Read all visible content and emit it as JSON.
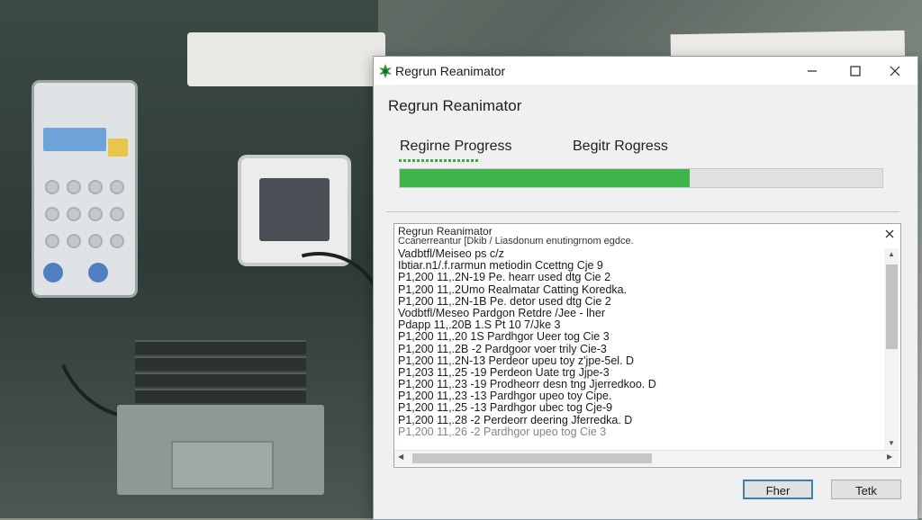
{
  "window": {
    "title": "Regrun Reanimator",
    "controls": {
      "minimize_icon": "minimize-icon",
      "maximize_icon": "maximize-icon",
      "close_icon": "close-icon"
    }
  },
  "main": {
    "heading": "Regrun Reanimator",
    "progress_label_1": "Regirne Progress",
    "progress_label_2": "Begitr Rogress",
    "progress_fraction": 0.6,
    "progress_color": "#40b34a"
  },
  "log": {
    "title": "Regrun Reanimator",
    "subtitle": "Ccanerreantur [Dkib / Liasdonum enutingrnom egdce.",
    "lines": [
      "Vadbtfl/Meiseo ps c/z",
      "Ibtiar.n1/.f.rarmun metiodin Ccettng Cje 9",
      "P1,200 11,.2N-19 Pe. hearr used dtg Cie 2",
      "P1,200 11,.2Umo Realmatar Catting Koredka.",
      "P1,200 11,.2N-1B Pe. detor used dtg Cie 2",
      "Vodbtfl/Meseo Pardgon Retdre /Jee - lher",
      "Pdapp 11,.20B 1.S Pt        10 7/Jke 3",
      "P1,200 11,.20 1S Pardhgor Ueer tog Cie 3",
      "P1,200 11,.2B -2 Pardgoor voer trily Cie-3",
      "P1,200 11,.2N-13 Perdeor upeu toy z'jpe-5el.    D",
      "P1,203 11,.25 -19 Perdeon Uate trg Jjpe-3",
      "P1,200 11,.23 -19 Prodheorr desn tng Jjerredkoo.   D",
      "P1,200 11,.23 -13 Pardhgor upeo toy Cipe.",
      "P1,200 11,.25 -13 Pardhgor ubec tog Cje-9",
      "P1,200 11,.28 -2 Perdeorr deering Jferredka.    D",
      "P1,200 11,.26 -2 Pardhgor upeo tog Cie 3"
    ]
  },
  "buttons": {
    "primary_label": "Fher",
    "secondary_label": "Tetk"
  }
}
